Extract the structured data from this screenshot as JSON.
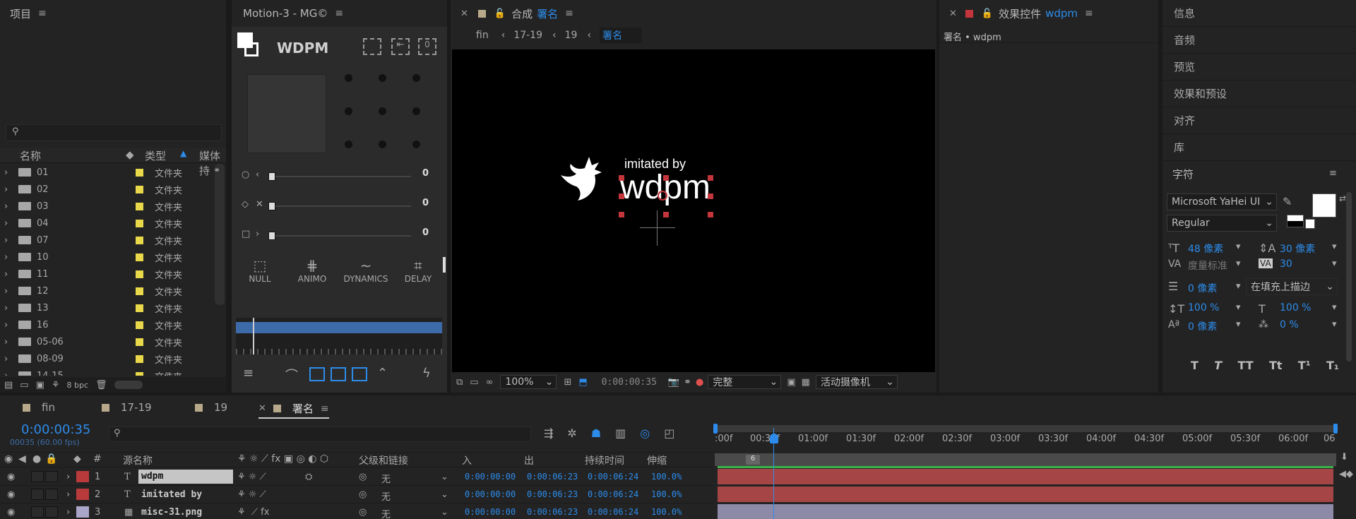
{
  "project": {
    "title": "项目",
    "search_placeholder": "",
    "col_name": "名称",
    "col_type": "类型",
    "col_media": "媒体持",
    "bpc": "8 bpc",
    "items": [
      {
        "name": "01",
        "type": "文件夹"
      },
      {
        "name": "02",
        "type": "文件夹"
      },
      {
        "name": "03",
        "type": "文件夹"
      },
      {
        "name": "04",
        "type": "文件夹"
      },
      {
        "name": "07",
        "type": "文件夹"
      },
      {
        "name": "10",
        "type": "文件夹"
      },
      {
        "name": "11",
        "type": "文件夹"
      },
      {
        "name": "12",
        "type": "文件夹"
      },
      {
        "name": "13",
        "type": "文件夹"
      },
      {
        "name": "16",
        "type": "文件夹"
      },
      {
        "name": "05-06",
        "type": "文件夹"
      },
      {
        "name": "08-09",
        "type": "文件夹"
      },
      {
        "name": "14-15",
        "type": "文件夹"
      }
    ]
  },
  "motion": {
    "title": "Motion-3 - MG©",
    "brand": "WDPM",
    "sliders": [
      {
        "value": "0"
      },
      {
        "value": "0"
      },
      {
        "value": "0"
      }
    ],
    "buttons": [
      "NULL",
      "ANIMO",
      "DYNAMICS",
      "DELAY"
    ]
  },
  "comp": {
    "title_prefix": "合成",
    "title_name": "署名",
    "breadcrumbs": [
      "fin",
      "17-19",
      "19",
      "署名"
    ],
    "text_small": "imitated by",
    "text_big": "wdpm",
    "zoom": "100%",
    "timecode": "0:00:00:35",
    "resolution": "完整",
    "camera": "活动摄像机"
  },
  "effects": {
    "title": "效果控件",
    "name": "wdpm",
    "path": "署名 • wdpm"
  },
  "right_panels": [
    "信息",
    "音频",
    "预览",
    "效果和预设",
    "对齐",
    "库"
  ],
  "character": {
    "title": "字符",
    "font": "Microsoft YaHei UI",
    "style": "Regular",
    "size": "48 像素",
    "leading": "30 像素",
    "kerning": "度量标准",
    "tracking": "30",
    "stroke_width": "0 像素",
    "stroke_mode": "在填充上描边",
    "vscale": "100 %",
    "hscale": "100 %",
    "baseline": "0 像素",
    "tsume": "0 %",
    "styles": [
      "T",
      "T",
      "TT",
      "Tt",
      "T¹",
      "T₁"
    ]
  },
  "timeline": {
    "tabs": [
      {
        "label": "fin"
      },
      {
        "label": "17-19"
      },
      {
        "label": "19"
      },
      {
        "label": "署名"
      }
    ],
    "timecode": "0:00:00:35",
    "fps": "00035 (60.00 fps)",
    "search_placeholder": "",
    "columns": {
      "num": "#",
      "source": "源名称",
      "parent": "父级和链接",
      "in": "入",
      "out": "出",
      "duration": "持续时间",
      "stretch": "伸缩"
    },
    "ruler": [
      ":00f",
      "00:30f",
      "01:00f",
      "01:30f",
      "02:00f",
      "02:30f",
      "03:00f",
      "03:30f",
      "04:00f",
      "04:30f",
      "05:00f",
      "05:30f",
      "06:00f",
      "06"
    ],
    "marker": "6",
    "layers": [
      {
        "num": "1",
        "name": "wdpm",
        "parent": "无",
        "in": "0:00:00:00",
        "out": "0:00:06:23",
        "dur": "0:00:06:24",
        "stretch": "100.0%",
        "color": "#b93a3a"
      },
      {
        "num": "2",
        "name": "imitated by",
        "parent": "无",
        "in": "0:00:00:00",
        "out": "0:00:06:23",
        "dur": "0:00:06:24",
        "stretch": "100.0%",
        "color": "#b93a3a"
      },
      {
        "num": "3",
        "name": "misc-31.png",
        "parent": "无",
        "in": "0:00:00:00",
        "out": "0:00:06:23",
        "dur": "0:00:06:24",
        "stretch": "100.0%",
        "color": "#a9a6c9"
      }
    ]
  },
  "colors": {
    "accent": "#2d8ceb",
    "label_red": "#b93a3a",
    "folder_label": "#e8d84a",
    "bar_red": "#a64546",
    "bar_lav": "#8c8aa6"
  }
}
